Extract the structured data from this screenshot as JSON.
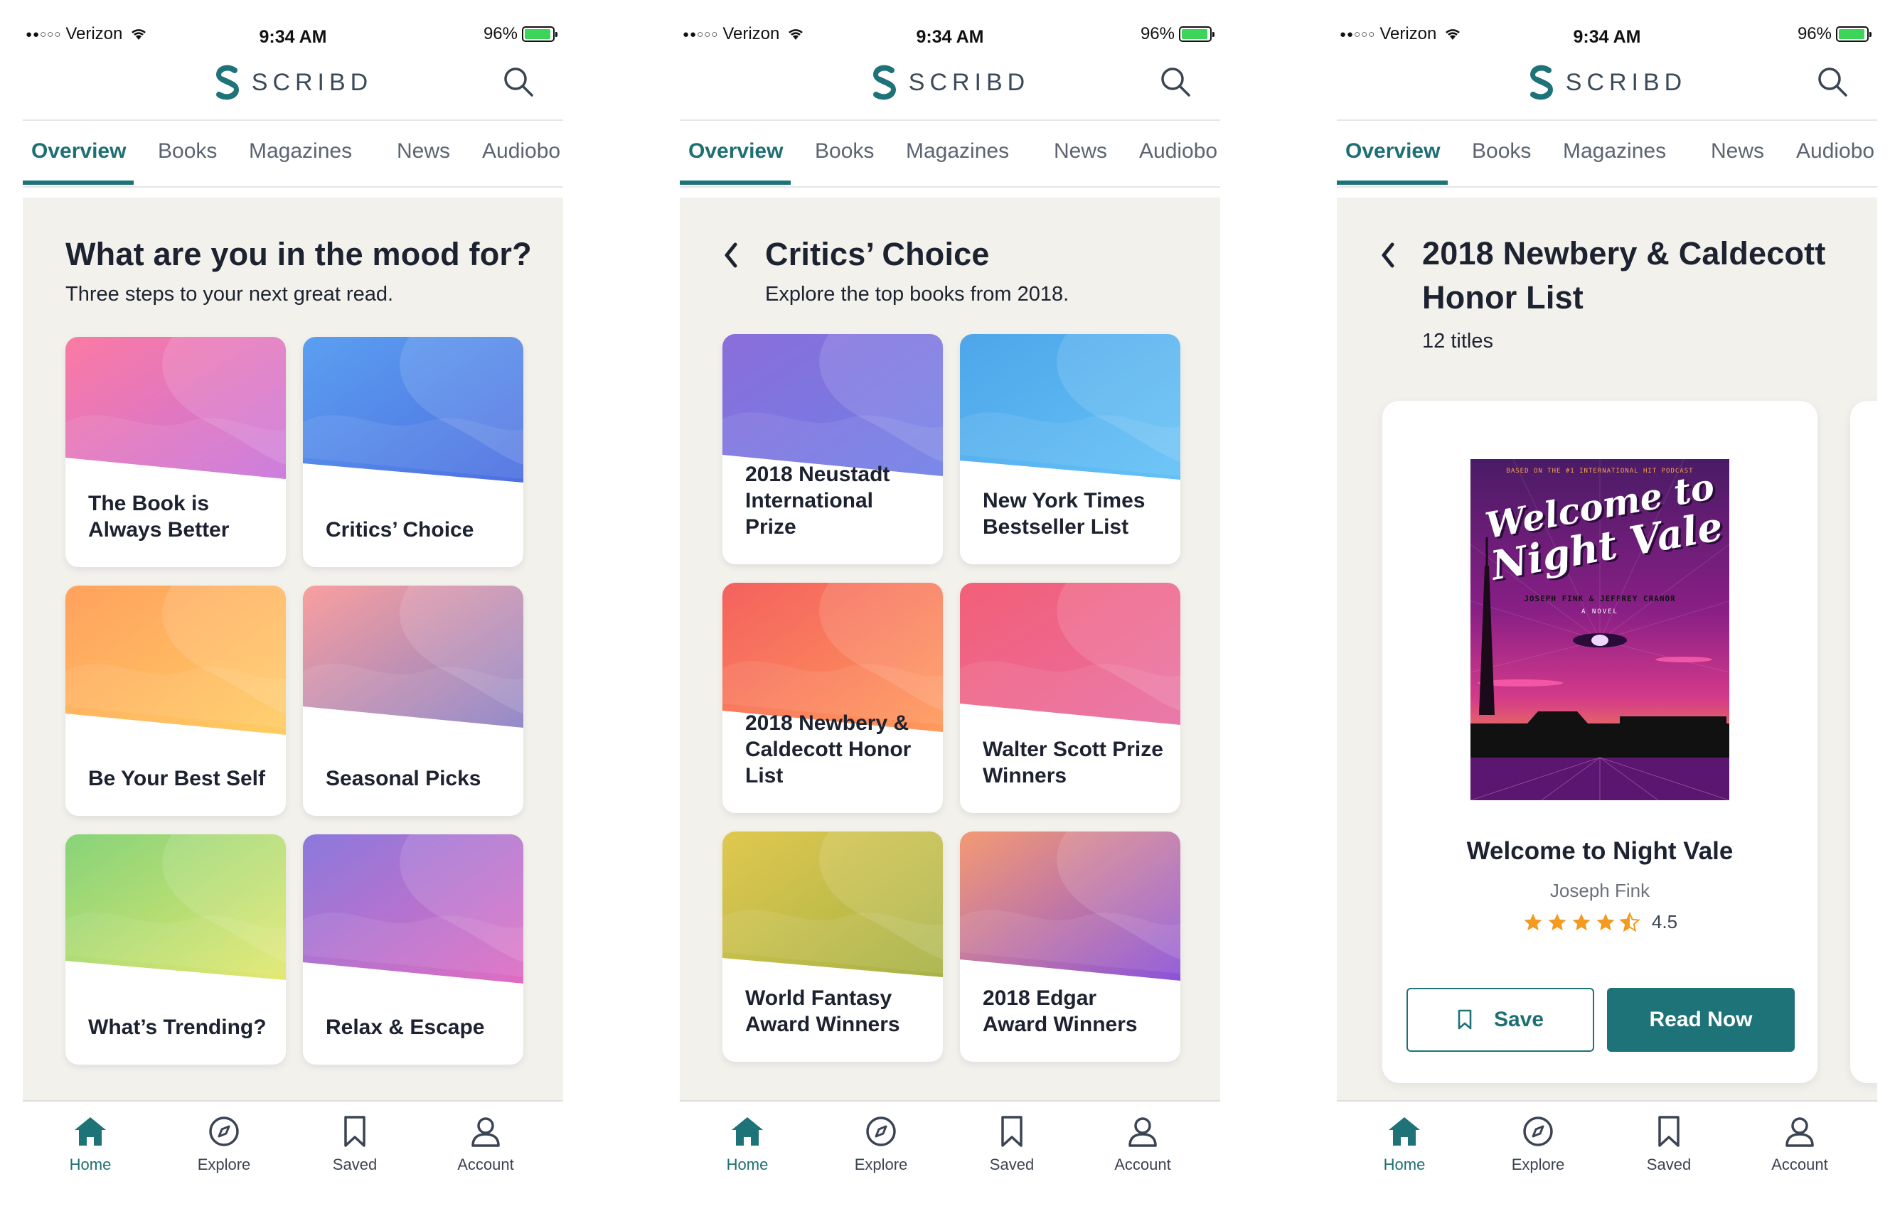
{
  "status_bar": {
    "carrier": "Verizon",
    "time": "9:34 AM",
    "battery": "96%",
    "battery_level": 0.96,
    "battery_color": "#3dd45a"
  },
  "brand": {
    "name": "SCRIBD",
    "accent": "#1e7378"
  },
  "tabs": [
    "Overview",
    "Books",
    "Magazines",
    "News",
    "Audiobo"
  ],
  "bottom_nav": [
    {
      "label": "Home",
      "icon": "home-icon"
    },
    {
      "label": "Explore",
      "icon": "compass-icon"
    },
    {
      "label": "Saved",
      "icon": "bookmark-icon"
    },
    {
      "label": "Account",
      "icon": "account-icon"
    }
  ],
  "screens": [
    {
      "title": "What are you in the mood for?",
      "subtitle": "Three steps to your next great read.",
      "cards": [
        {
          "label": "The Book is Always Better",
          "colors": [
            "#fb7aa3",
            "#c874dc"
          ]
        },
        {
          "label": "Critics’ Choice",
          "colors": [
            "#5b9ff1",
            "#4d6fe0"
          ]
        },
        {
          "label": "Be Your Best Self",
          "colors": [
            "#ffa15e",
            "#ffcd63"
          ]
        },
        {
          "label": "Seasonal Picks",
          "colors": [
            "#f99f9f",
            "#8b82c6"
          ]
        },
        {
          "label": "What’s Trending?",
          "colors": [
            "#87d37a",
            "#e3e86d"
          ]
        },
        {
          "label": "Relax & Escape",
          "colors": [
            "#8b79dc",
            "#e06cc2"
          ]
        }
      ]
    },
    {
      "title": "Critics’ Choice",
      "subtitle": "Explore the top books from 2018.",
      "cards": [
        {
          "label": "2018 Neustadt International Prize",
          "colors": [
            "#8a6edb",
            "#6f7ee6"
          ]
        },
        {
          "label": "New York Times Bestseller List",
          "colors": [
            "#4ea6ea",
            "#63c1f6"
          ]
        },
        {
          "label": "2018 Newbery & Caldecott Honor List",
          "colors": [
            "#f4615e",
            "#ff9a5c"
          ]
        },
        {
          "label": "Walter Scott Prize Winners",
          "colors": [
            "#f35f77",
            "#e86ea3"
          ]
        },
        {
          "label": "World Fantasy Award Winners",
          "colors": [
            "#e0c84f",
            "#a6b246"
          ]
        },
        {
          "label": "2018 Edgar Award Winners",
          "colors": [
            "#f49a73",
            "#8b52d9"
          ]
        }
      ]
    },
    {
      "title_line1": "2018 Newbery & Caldecott",
      "title_line2": "Honor List",
      "count": "12 titles",
      "book": {
        "title": "Welcome to Night Vale",
        "author": "Joseph Fink",
        "rating": "4.5",
        "rating_value": 4.5,
        "save_label": "Save",
        "read_label": "Read Now",
        "cover": {
          "tagline": "BASED ON THE #1 INTERNATIONAL HIT PODCAST",
          "title_line1": "Welcome to",
          "title_line2": "Night Vale",
          "authors": "JOSEPH FINK & JEFFREY CRANOR",
          "kind": "A NOVEL"
        }
      }
    }
  ]
}
